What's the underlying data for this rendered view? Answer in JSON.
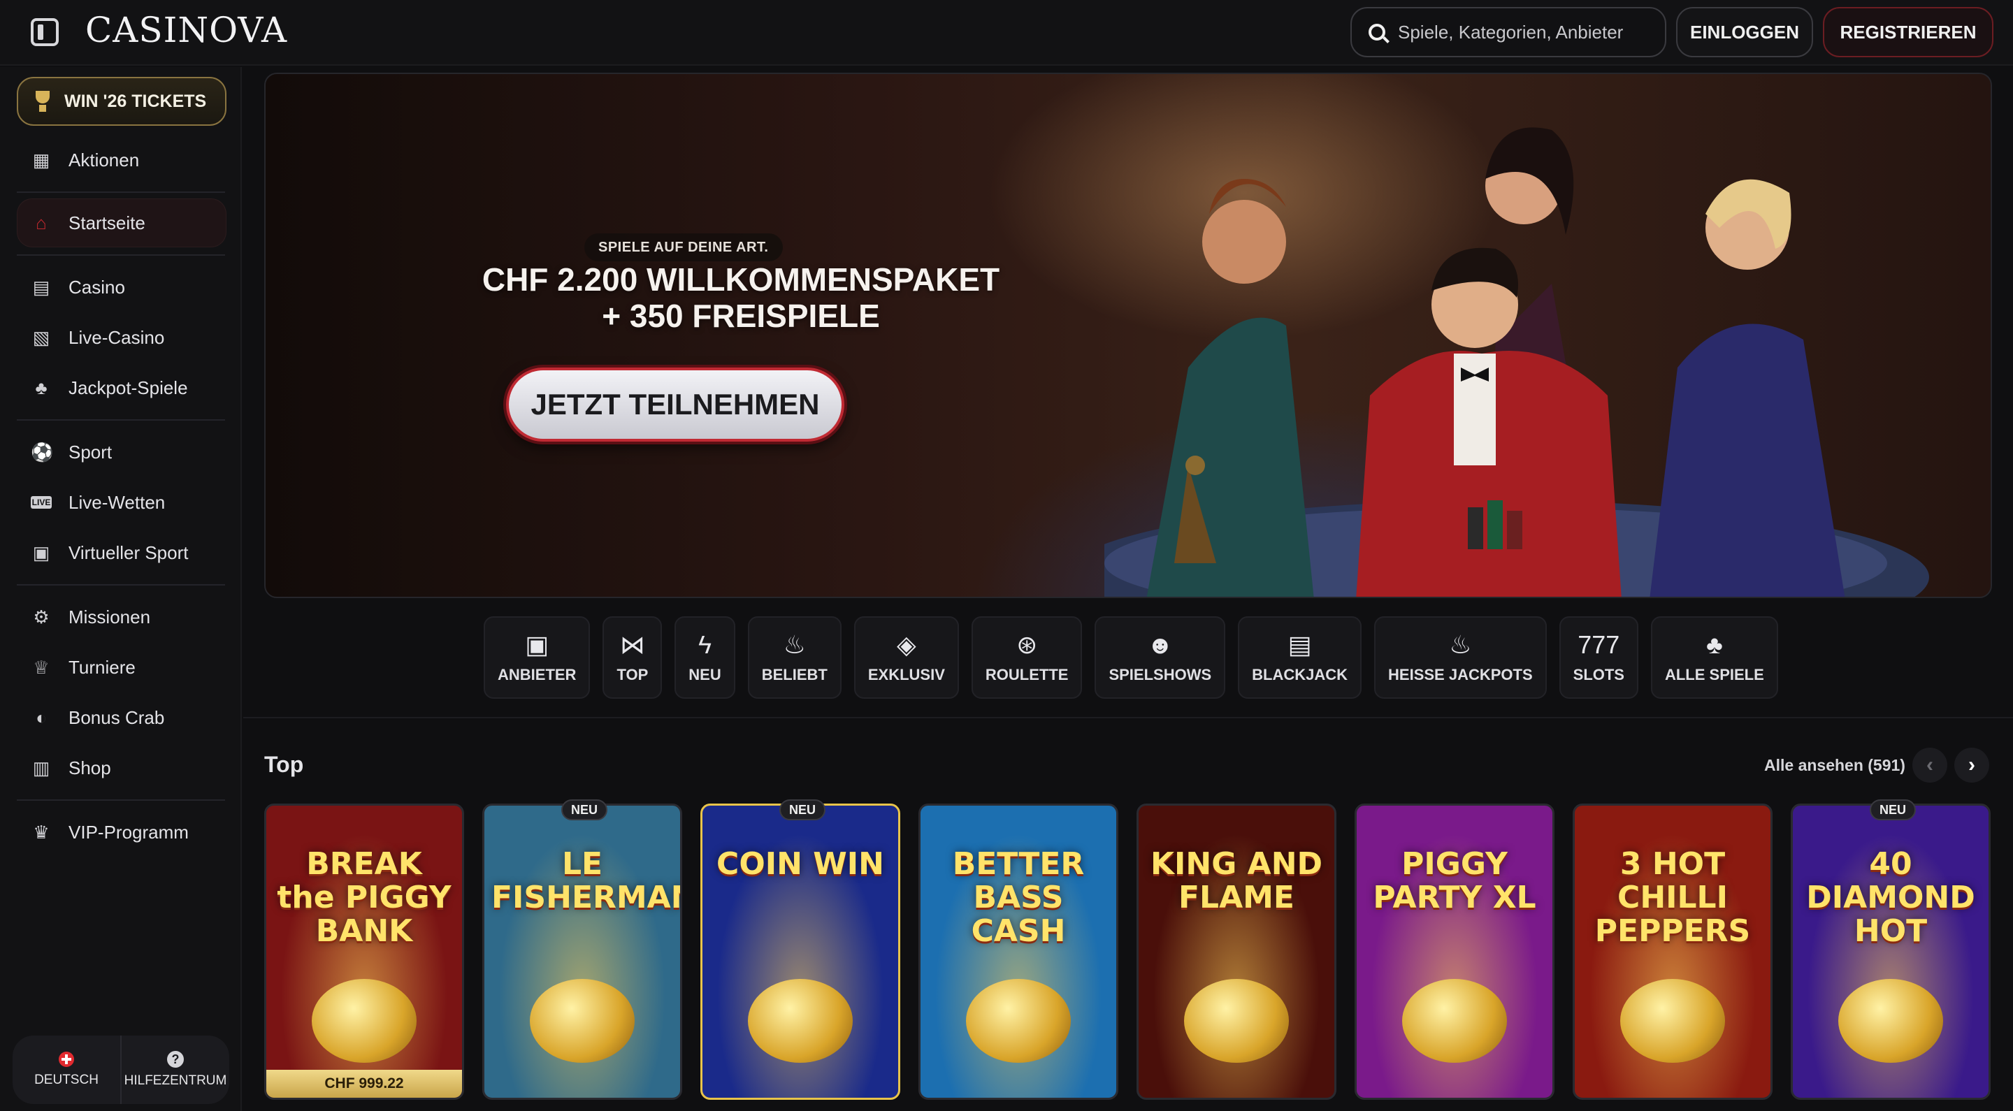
{
  "header": {
    "logo": "CASINOVA",
    "search_placeholder": "Spiele, Kategorien, Anbieter",
    "login_label": "EINLOGGEN",
    "register_label": "REGISTRIEREN"
  },
  "sidebar": {
    "tickets_label": "WIN '26 TICKETS",
    "items": [
      {
        "label": "Aktionen",
        "icon": "gift-icon"
      },
      {
        "label": "Startseite",
        "icon": "home-icon"
      },
      {
        "label": "Casino",
        "icon": "slot-machine-icon"
      },
      {
        "label": "Live-Casino",
        "icon": "cards-icon"
      },
      {
        "label": "Jackpot-Spiele",
        "icon": "clover-icon"
      },
      {
        "label": "Sport",
        "icon": "soccer-ball-icon"
      },
      {
        "label": "Live-Wetten",
        "icon": "live-icon"
      },
      {
        "label": "Virtueller Sport",
        "icon": "virtual-sport-icon"
      },
      {
        "label": "Missionen",
        "icon": "mission-icon"
      },
      {
        "label": "Turniere",
        "icon": "trophy-icon"
      },
      {
        "label": "Bonus Crab",
        "icon": "crab-claw-icon"
      },
      {
        "label": "Shop",
        "icon": "shop-icon"
      },
      {
        "label": "VIP-Programm",
        "icon": "crown-icon"
      }
    ],
    "active_item": "Startseite",
    "language_label": "DEUTSCH",
    "help_label": "HILFEZENTRUM"
  },
  "hero": {
    "tag": "SPIELE AUF DEINE ART.",
    "title_line1": "CHF 2.200 WILLKOMMENSPAKET",
    "title_line2": "+ 350 FREISPIELE",
    "cta": "JETZT TEILNEHMEN"
  },
  "categories": [
    {
      "label": "ANBIETER",
      "icon": "provider-icon",
      "glyph": "▣"
    },
    {
      "label": "TOP",
      "icon": "bowtie-icon",
      "glyph": "⋈"
    },
    {
      "label": "NEU",
      "icon": "lightning-icon",
      "glyph": "ϟ"
    },
    {
      "label": "BELIEBT",
      "icon": "flame-icon",
      "glyph": "♨"
    },
    {
      "label": "EXKLUSIV",
      "icon": "diamond-icon",
      "glyph": "◈"
    },
    {
      "label": "ROULETTE",
      "icon": "roulette-icon",
      "glyph": "⊛"
    },
    {
      "label": "SPIELSHOWS",
      "icon": "mask-icon",
      "glyph": "☻"
    },
    {
      "label": "BLACKJACK",
      "icon": "cards-icon",
      "glyph": "▤"
    },
    {
      "label": "HEISSE JACKPOTS",
      "icon": "chili-icon",
      "glyph": "♨"
    },
    {
      "label": "SLOTS",
      "icon": "seven-icon",
      "glyph": "777"
    },
    {
      "label": "ALLE SPIELE",
      "icon": "suits-icon",
      "glyph": "♣"
    }
  ],
  "games_section": {
    "title": "Top",
    "view_all": "Alle ansehen (591)",
    "games": [
      {
        "title": "BREAK the PIGGY BANK",
        "badge": "",
        "jackpot": "CHF 999.22",
        "bg": "#7a1414"
      },
      {
        "title": "LE FISHERMAN",
        "badge": "NEU",
        "jackpot": "",
        "bg": "#2f6a8a"
      },
      {
        "title": "COIN WIN",
        "badge": "NEU",
        "jackpot": "",
        "bg": "#1a2a8a"
      },
      {
        "title": "BETTER BASS CASH",
        "badge": "",
        "jackpot": "",
        "bg": "#1c6fb0"
      },
      {
        "title": "KING AND FLAME",
        "badge": "",
        "jackpot": "",
        "bg": "#4a0f0a"
      },
      {
        "title": "PIGGY PARTY XL",
        "badge": "",
        "jackpot": "",
        "bg": "#7a1a8a"
      },
      {
        "title": "3 HOT CHILLI PEPPERS",
        "badge": "",
        "jackpot": "",
        "bg": "#8a1a10"
      },
      {
        "title": "40 DIAMOND HOT",
        "badge": "NEU",
        "jackpot": "",
        "bg": "#3a1a8a"
      }
    ]
  },
  "colors": {
    "accent_red": "#c0282e",
    "gold": "#d8b45a",
    "background": "#0f0f11"
  }
}
